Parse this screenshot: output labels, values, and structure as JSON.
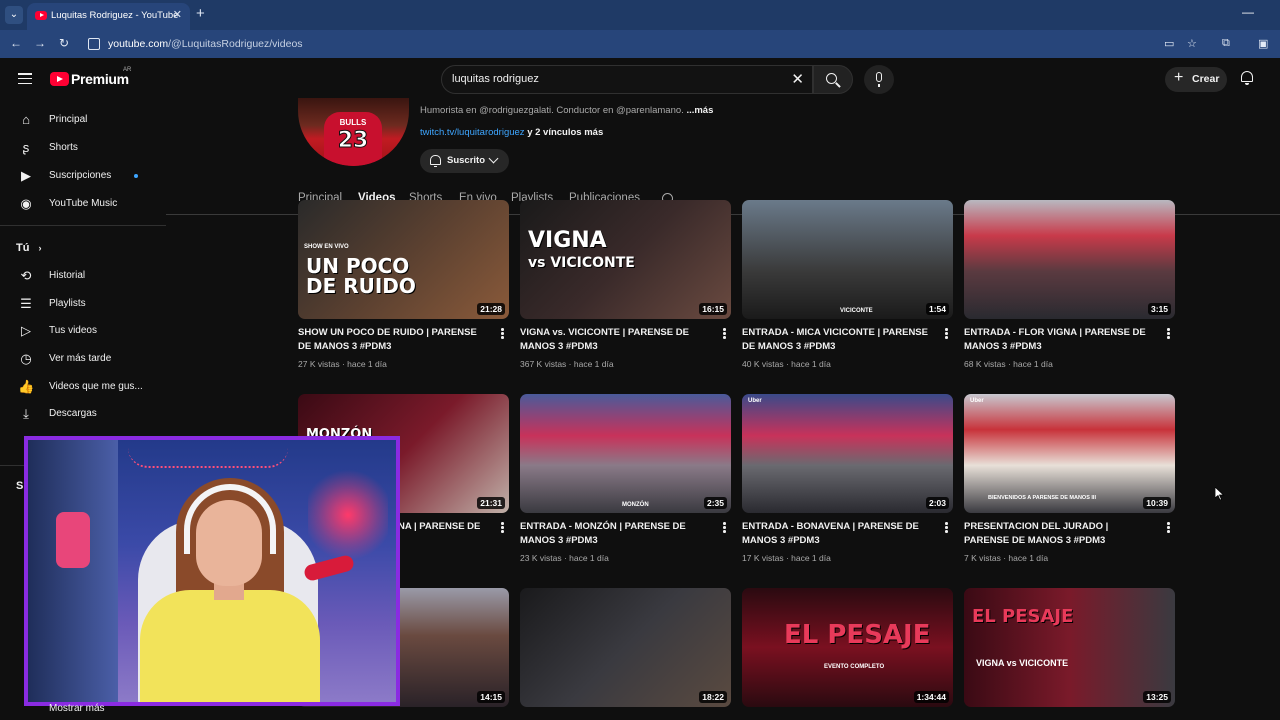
{
  "browser": {
    "tab_title": "Luquitas Rodriguez - YouTube",
    "url_domain": "youtube.com",
    "url_path": "/@LuquitasRodriguez/videos"
  },
  "header": {
    "logo_text": "Premium",
    "logo_country": "AR",
    "search_value": "luquitas rodriguez",
    "create_label": "Crear"
  },
  "sidebar": {
    "items": [
      {
        "label": "Principal",
        "icon": "home-icon"
      },
      {
        "label": "Shorts",
        "icon": "shorts-icon"
      },
      {
        "label": "Suscripciones",
        "icon": "subscriptions-icon"
      },
      {
        "label": "YouTube Music",
        "icon": "music-icon"
      }
    ],
    "you_heading": "Tú",
    "you_items": [
      {
        "label": "Historial",
        "icon": "history-icon"
      },
      {
        "label": "Playlists",
        "icon": "playlists-icon"
      },
      {
        "label": "Tus videos",
        "icon": "your-videos-icon"
      },
      {
        "label": "Ver más tarde",
        "icon": "watch-later-icon"
      },
      {
        "label": "Videos que me gus...",
        "icon": "liked-icon"
      },
      {
        "label": "Descargas",
        "icon": "downloads-icon"
      }
    ],
    "subs_heading": "S",
    "more_label": "Mostrar más"
  },
  "channel": {
    "bio": "Humorista en @rodriguezgalati.  Conductor en @parenlamano.",
    "bio_more": "...más",
    "link_url": "twitch.tv/luquitarodriguez",
    "link_more": "y 2 vínculos más",
    "subscribed_label": "Suscrito",
    "jersey_team": "BULLS",
    "jersey_number": "23",
    "tabs": [
      "Principal",
      "Videos",
      "Shorts",
      "En vivo",
      "Playlists",
      "Publicaciones"
    ],
    "active_tab": "Videos"
  },
  "videos": [
    {
      "title": "SHOW UN POCO DE RUIDO | PARENSE DE MANOS 3 #PDM3",
      "views": "27 K vistas",
      "age": "hace 1 día",
      "duration": "21:28",
      "overlay": "UN POCO DE RUIDO",
      "overlay_small": "SHOW EN VIVO"
    },
    {
      "title": "VIGNA vs. VICICONTE | PARENSE DE MANOS 3 #PDM3",
      "views": "367 K vistas",
      "age": "hace 1 día",
      "duration": "16:15",
      "overlay": "VIGNA",
      "overlay_small": "vs VICICONTE"
    },
    {
      "title": "ENTRADA - MICA VICICONTE | PARENSE DE MANOS 3 #PDM3",
      "views": "40 K vistas",
      "age": "hace 1 día",
      "duration": "1:54",
      "overlay": "",
      "overlay_small": "VICICONTE"
    },
    {
      "title": "ENTRADA - FLOR VIGNA | PARENSE DE MANOS 3 #PDM3",
      "views": "68 K vistas",
      "age": "hace 1 día",
      "duration": "3:15",
      "overlay": "",
      "overlay_small": ""
    },
    {
      "title": "NA | PARENSE DE",
      "views": "",
      "age": "",
      "duration": "21:31",
      "overlay": "MONZÓN",
      "overlay_small": ""
    },
    {
      "title": "ENTRADA - MONZÓN | PARENSE DE MANOS 3 #PDM3",
      "views": "23 K vistas",
      "age": "hace 1 día",
      "duration": "2:35",
      "overlay": "",
      "overlay_small": "MONZÓN"
    },
    {
      "title": "ENTRADA - BONAVENA | PARENSE DE MANOS 3 #PDM3",
      "views": "17 K vistas",
      "age": "hace 1 día",
      "duration": "2:03",
      "overlay": "",
      "overlay_small": "Uber"
    },
    {
      "title": "PRESENTACION DEL JURADO | PARENSE DE MANOS 3 #PDM3",
      "views": "7 K vistas",
      "age": "hace 1 día",
      "duration": "10:39",
      "overlay": "BIENVENIDOS A PARENSE DE MANOS III",
      "overlay_small": "Uber"
    },
    {
      "title": "",
      "views": "",
      "age": "",
      "duration": "14:15",
      "overlay": "",
      "overlay_small": ""
    },
    {
      "title": "",
      "views": "",
      "age": "",
      "duration": "18:22",
      "overlay": "",
      "overlay_small": ""
    },
    {
      "title": "",
      "views": "",
      "age": "",
      "duration": "1:34:44",
      "overlay": "EL PESAJE",
      "overlay_small": "EVENTO COMPLETO"
    },
    {
      "title": "",
      "views": "",
      "age": "",
      "duration": "13:25",
      "overlay": "EL PESAJE",
      "overlay_small": "VIGNA vs VICICONTE"
    }
  ],
  "colors": {
    "page_bg": "#0f0f0f",
    "brand_red": "#ff0033",
    "link_blue": "#3ea6ff",
    "browser_chrome": "#1f3a66",
    "webcam_border": "#8a2be2"
  }
}
